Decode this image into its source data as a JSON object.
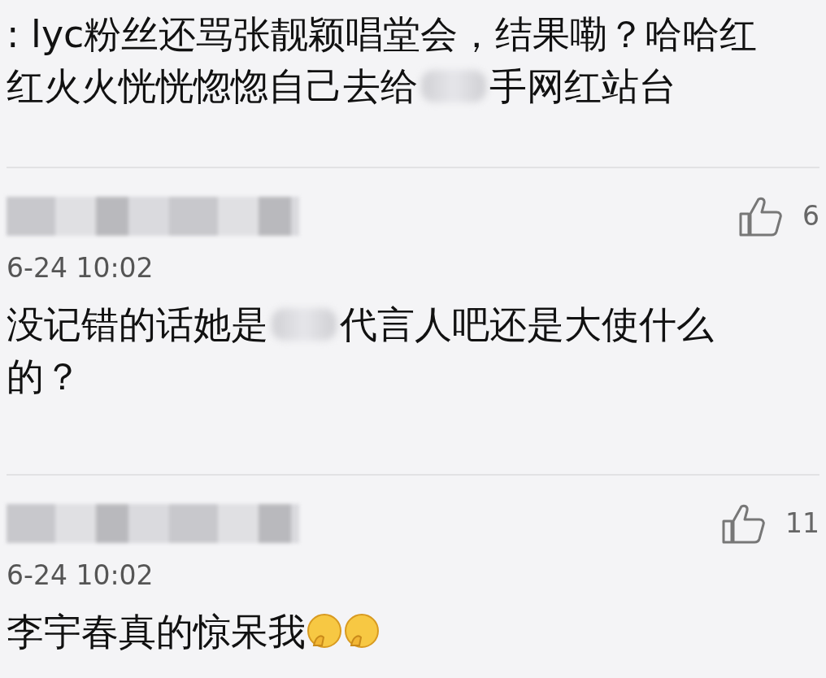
{
  "comments": [
    {
      "lines": [
        [
          {
            "kind": "text",
            "text": ": lyc粉丝还骂张靓颖唱堂会，结果嘞？哈哈红"
          }
        ],
        [
          {
            "kind": "text",
            "text": "红火火恍恍惚惚自己去给"
          },
          {
            "kind": "redacted"
          },
          {
            "kind": "text",
            "text": "手网红站台"
          }
        ]
      ]
    },
    {
      "author": {
        "kind": "redacted"
      },
      "likes": "6",
      "time": "6-24 10:02",
      "lines": [
        [
          {
            "kind": "text",
            "text": "没记错的话她是"
          },
          {
            "kind": "redacted"
          },
          {
            "kind": "text",
            "text": "代言人吧还是大使什么"
          }
        ],
        [
          {
            "kind": "text",
            "text": "的？"
          }
        ]
      ]
    },
    {
      "author": {
        "kind": "redacted"
      },
      "likes": "11",
      "time": "6-24 10:02",
      "lines": [
        [
          {
            "kind": "text",
            "text": "李宇春真的惊呆我"
          },
          {
            "kind": "emoji"
          },
          {
            "kind": "emoji"
          }
        ]
      ]
    }
  ]
}
